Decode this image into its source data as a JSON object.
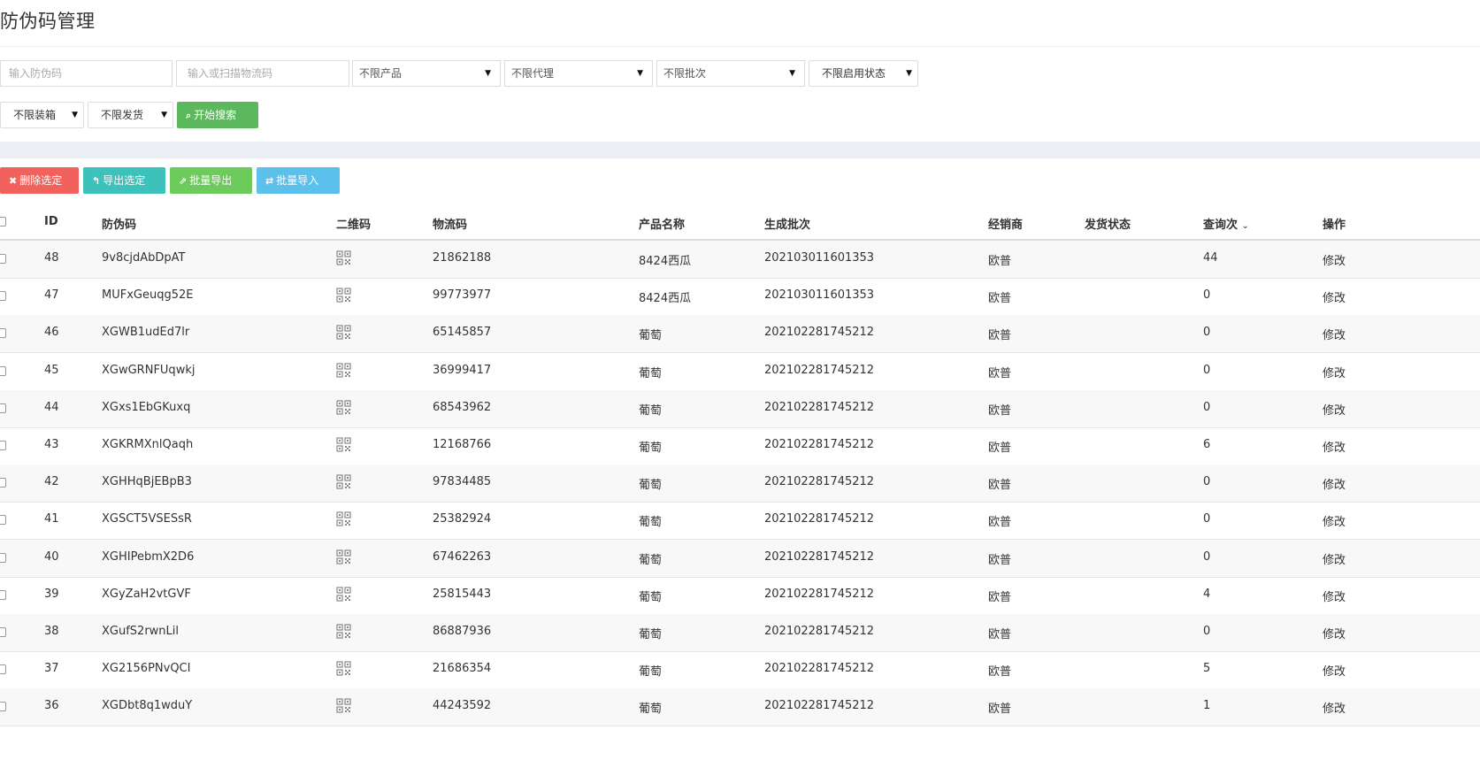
{
  "page": {
    "title": "防伪码管理"
  },
  "filters": {
    "code_placeholder": "输入防伪码",
    "logistics_placeholder": "输入或扫描物流码",
    "product": "不限产品",
    "agent": "不限代理",
    "batch": "不限批次",
    "enable_status": "不限启用状态",
    "packing": "不限装箱",
    "shipping": "不限发货",
    "search_button": "开始搜索"
  },
  "actions": {
    "delete": "删除选定",
    "export_selected": "导出选定",
    "batch_export": "批量导出",
    "batch_import": "批量导入"
  },
  "table": {
    "headers": {
      "id": "ID",
      "code": "防伪码",
      "qr": "二维码",
      "logistics": "物流码",
      "product": "产品名称",
      "batch": "生成批次",
      "dealer": "经销商",
      "ship_status": "发货状态",
      "query_count": "查询次",
      "op": "操作"
    },
    "rows": [
      {
        "id": "48",
        "code": "9v8cjdAbDpAT",
        "logistics": "21862188",
        "product": "8424西瓜",
        "batch": "202103011601353",
        "dealer": "欧普",
        "ship": "",
        "query": "44",
        "op": "修改"
      },
      {
        "id": "47",
        "code": "MUFxGeuqg52E",
        "logistics": "99773977",
        "product": "8424西瓜",
        "batch": "202103011601353",
        "dealer": "欧普",
        "ship": "",
        "query": "0",
        "op": "修改"
      },
      {
        "id": "46",
        "code": "XGWB1udEd7lr",
        "logistics": "65145857",
        "product": "葡萄",
        "batch": "202102281745212",
        "dealer": "欧普",
        "ship": "",
        "query": "0",
        "op": "修改"
      },
      {
        "id": "45",
        "code": "XGwGRNFUqwkj",
        "logistics": "36999417",
        "product": "葡萄",
        "batch": "202102281745212",
        "dealer": "欧普",
        "ship": "",
        "query": "0",
        "op": "修改"
      },
      {
        "id": "44",
        "code": "XGxs1EbGKuxq",
        "logistics": "68543962",
        "product": "葡萄",
        "batch": "202102281745212",
        "dealer": "欧普",
        "ship": "",
        "query": "0",
        "op": "修改"
      },
      {
        "id": "43",
        "code": "XGKRMXnlQaqh",
        "logistics": "12168766",
        "product": "葡萄",
        "batch": "202102281745212",
        "dealer": "欧普",
        "ship": "",
        "query": "6",
        "op": "修改"
      },
      {
        "id": "42",
        "code": "XGHHqBjEBpB3",
        "logistics": "97834485",
        "product": "葡萄",
        "batch": "202102281745212",
        "dealer": "欧普",
        "ship": "",
        "query": "0",
        "op": "修改"
      },
      {
        "id": "41",
        "code": "XGSCT5VSESsR",
        "logistics": "25382924",
        "product": "葡萄",
        "batch": "202102281745212",
        "dealer": "欧普",
        "ship": "",
        "query": "0",
        "op": "修改"
      },
      {
        "id": "40",
        "code": "XGHIPebmX2D6",
        "logistics": "67462263",
        "product": "葡萄",
        "batch": "202102281745212",
        "dealer": "欧普",
        "ship": "",
        "query": "0",
        "op": "修改"
      },
      {
        "id": "39",
        "code": "XGyZaH2vtGVF",
        "logistics": "25815443",
        "product": "葡萄",
        "batch": "202102281745212",
        "dealer": "欧普",
        "ship": "",
        "query": "4",
        "op": "修改"
      },
      {
        "id": "38",
        "code": "XGufS2rwnLil",
        "logistics": "86887936",
        "product": "葡萄",
        "batch": "202102281745212",
        "dealer": "欧普",
        "ship": "",
        "query": "0",
        "op": "修改"
      },
      {
        "id": "37",
        "code": "XG2156PNvQCI",
        "logistics": "21686354",
        "product": "葡萄",
        "batch": "202102281745212",
        "dealer": "欧普",
        "ship": "",
        "query": "5",
        "op": "修改"
      },
      {
        "id": "36",
        "code": "XGDbt8q1wduY",
        "logistics": "44243592",
        "product": "葡萄",
        "batch": "202102281745212",
        "dealer": "欧普",
        "ship": "",
        "query": "1",
        "op": "修改"
      }
    ]
  }
}
